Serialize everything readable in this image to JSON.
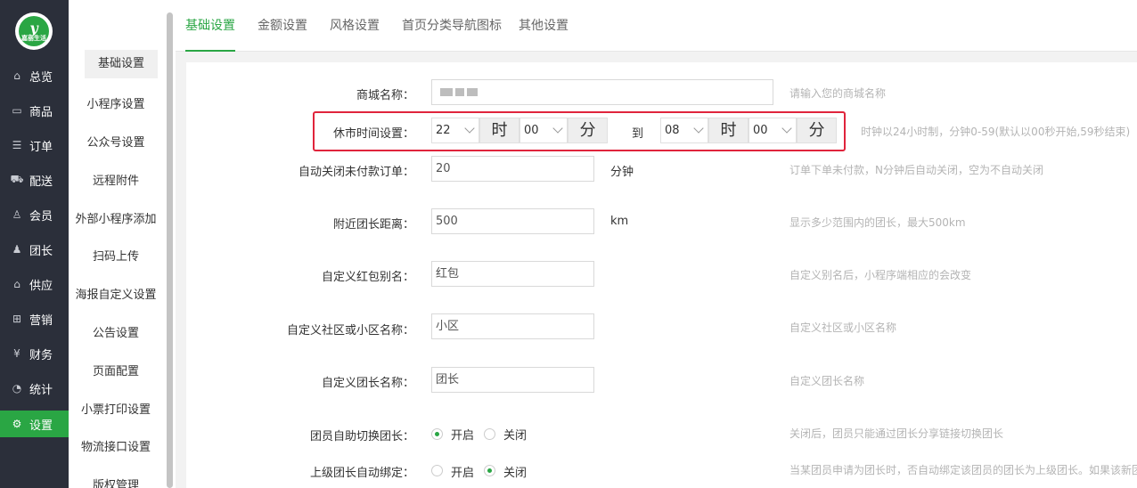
{
  "logo": {
    "brand_big": "y",
    "brand_small": "嘉丽生活"
  },
  "nav": {
    "items": [
      {
        "label": "总览",
        "icon": "home-icon",
        "glyph": "⌂"
      },
      {
        "label": "商品",
        "icon": "box-icon",
        "glyph": "▭"
      },
      {
        "label": "订单",
        "icon": "order-icon",
        "glyph": "☰"
      },
      {
        "label": "配送",
        "icon": "truck-icon",
        "glyph": "⛟"
      },
      {
        "label": "会员",
        "icon": "user-icon",
        "glyph": "♙"
      },
      {
        "label": "团长",
        "icon": "leader-icon",
        "glyph": "♟"
      },
      {
        "label": "供应",
        "icon": "supply-icon",
        "glyph": "⌂"
      },
      {
        "label": "营销",
        "icon": "gift-icon",
        "glyph": "⊞"
      },
      {
        "label": "财务",
        "icon": "finance-icon",
        "glyph": "¥"
      },
      {
        "label": "统计",
        "icon": "chart-icon",
        "glyph": "◔"
      },
      {
        "label": "设置",
        "icon": "gear-icon",
        "glyph": "⚙"
      }
    ],
    "active_color": "#2aa644"
  },
  "submenu": {
    "items": [
      "基础设置",
      "小程序设置",
      "公众号设置",
      "远程附件",
      "外部小程序添加",
      "扫码上传",
      "海报自定义设置",
      "公告设置",
      "页面配置",
      "小票打印设置",
      "物流接口设置",
      "版权管理"
    ]
  },
  "tabs": [
    "基础设置",
    "金额设置",
    "风格设置",
    "首页分类导航图标",
    "其他设置"
  ],
  "form": {
    "shop_name": {
      "label": "商城名称：",
      "hint": "请输入您的商城名称"
    },
    "close_time": {
      "label": "休市时间设置：",
      "start_hour": "22",
      "start_min": "00",
      "end_hour": "08",
      "end_min": "00",
      "hour_unit": "时",
      "min_unit": "分",
      "to": "到",
      "hint": "时钟以24小时制，分钟0-59(默认以00秒开始,59秒结束)"
    },
    "auto_close": {
      "label": "自动关闭未付款订单：",
      "value": "20",
      "unit": "分钟",
      "hint": "订单下单未付款，N分钟后自动关闭，空为不自动关闭"
    },
    "nearby": {
      "label": "附近团长距离：",
      "value": "500",
      "unit": "km",
      "hint": "显示多少范围内的团长，最大500km"
    },
    "redpack": {
      "label": "自定义红包别名：",
      "value": "红包",
      "hint": "自定义别名后，小程序端相应的会改变"
    },
    "community": {
      "label": "自定义社区或小区名称：",
      "value": "小区",
      "hint": "自定义社区或小区名称"
    },
    "leader_name": {
      "label": "自定义团长名称：",
      "value": "团长",
      "hint": "自定义团长名称"
    },
    "self_switch": {
      "label": "团员自助切换团长：",
      "on": "开启",
      "off": "关闭",
      "hint": "关闭后，团员只能通过团长分享链接切换团长"
    },
    "auto_bind": {
      "label": "上级团长自动绑定：",
      "on": "开启",
      "off": "关闭",
      "hint": "当某团员申请为团长时，否自动绑定该团员的团长为上级团长。如果该新团"
    }
  }
}
